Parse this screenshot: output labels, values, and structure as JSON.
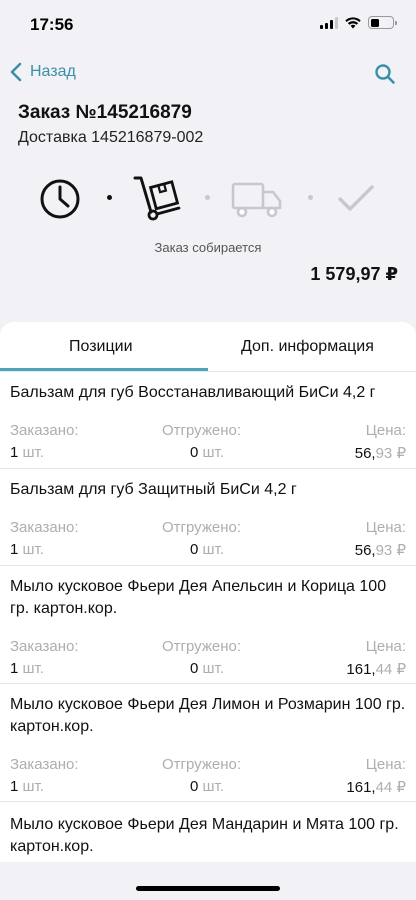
{
  "status_bar": {
    "time": "17:56"
  },
  "nav": {
    "back_label": "Назад"
  },
  "order": {
    "title": "Заказ №145216879",
    "delivery": "Доставка 145216879-002",
    "status": "Заказ собирается",
    "total": "1 579,97 ₽"
  },
  "tabs": [
    {
      "label": "Позиции",
      "active": true
    },
    {
      "label": "Доп. информация",
      "active": false
    }
  ],
  "columns": {
    "ordered": "Заказано:",
    "shipped": "Отгружено:",
    "price": "Цена:"
  },
  "items": [
    {
      "name": "Бальзам для губ Восстанавливающий БиСи 4,2 г",
      "ordered_qty": "1",
      "ordered_unit": "шт.",
      "shipped_qty": "0",
      "shipped_unit": "шт.",
      "price_int": "56,",
      "price_kop": "93",
      "currency": "₽"
    },
    {
      "name": "Бальзам для губ Защитный БиСи 4,2 г",
      "ordered_qty": "1",
      "ordered_unit": "шт.",
      "shipped_qty": "0",
      "shipped_unit": "шт.",
      "price_int": "56,",
      "price_kop": "93",
      "currency": "₽"
    },
    {
      "name": "Мыло кусковое Фьери Дея Апельсин и Корица 100 гр. картон.кор.",
      "ordered_qty": "1",
      "ordered_unit": "шт.",
      "shipped_qty": "0",
      "shipped_unit": "шт.",
      "price_int": "161,",
      "price_kop": "44",
      "currency": "₽"
    },
    {
      "name": "Мыло кусковое Фьери Дея Лимон и Розмарин 100 гр. картон.кор.",
      "ordered_qty": "1",
      "ordered_unit": "шт.",
      "shipped_qty": "0",
      "shipped_unit": "шт.",
      "price_int": "161,",
      "price_kop": "44",
      "currency": "₽"
    },
    {
      "name": "Мыло кусковое Фьери Дея Мандарин и Мята 100 гр. картон.кор."
    }
  ],
  "colors": {
    "accent": "#3b8fa8",
    "tab_underline": "#4fa3bc",
    "muted": "#aeaeb2",
    "background": "#f2f2f6"
  }
}
